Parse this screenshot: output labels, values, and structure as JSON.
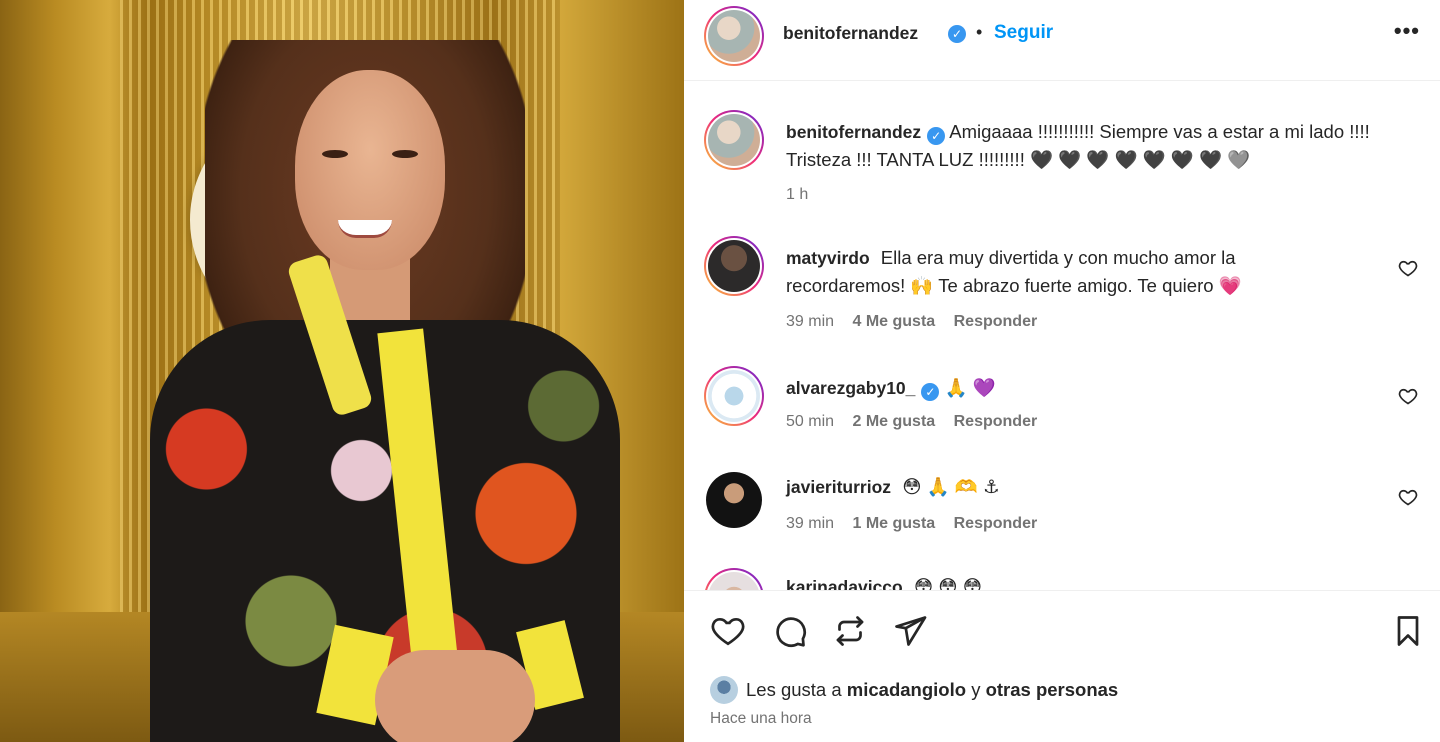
{
  "post": {
    "author": "benitofernandez",
    "follow_label": "Seguir",
    "separator": "•",
    "more_label": "•••"
  },
  "caption": {
    "username": "benitofernandez",
    "text": "Amigaaaa !!!!!!!!!!! Siempre vas a estar a mi lado !!!! Tristeza !!! TANTA LUZ !!!!!!!!! 🖤 🖤 🖤 🖤 🖤 🖤 🖤 🩶",
    "time": "1 h"
  },
  "comments": [
    {
      "username": "matyvirdo",
      "text": "Ella era muy divertida y con mucho amor la recordaremos! 🙌 Te abrazo fuerte amigo. Te quiero 💗",
      "time": "39 min",
      "likes": "4 Me gusta",
      "reply": "Responder",
      "verified": false
    },
    {
      "username": "alvarezgaby10_",
      "text": "🙏 💜",
      "time": "50 min",
      "likes": "2 Me gusta",
      "reply": "Responder",
      "verified": true
    },
    {
      "username": "javieriturrioz",
      "text": "😳 🙏 🫶 ⚓",
      "time": "39 min",
      "likes": "1 Me gusta",
      "reply": "Responder",
      "verified": false
    },
    {
      "username": "karinadavicco",
      "text": "😳 😳 😳",
      "verified": false
    }
  ],
  "actions": {
    "icons": [
      "heart-icon",
      "comment-icon",
      "repost-icon",
      "share-icon",
      "bookmark-icon"
    ]
  },
  "liked_by": {
    "prefix": "Les gusta a",
    "user": "micadangiolo",
    "connector": "y",
    "others": "otras personas"
  },
  "timestamp": "Hace una hora",
  "colors": {
    "link_blue": "#0095f6",
    "verified_blue": "#3897f0",
    "muted": "#737373",
    "text": "#262626"
  }
}
